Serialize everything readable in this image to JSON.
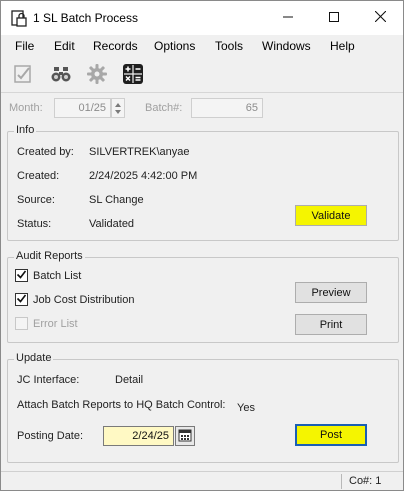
{
  "window": {
    "title": "1 SL Batch Process",
    "app_icon": "document-lock-icon",
    "controls": {
      "minimize": "minimize-icon",
      "maximize": "maximize-icon",
      "close": "close-icon"
    }
  },
  "menu": [
    "File",
    "Edit",
    "Records",
    "Options",
    "Tools",
    "Windows",
    "Help"
  ],
  "toolbar": [
    {
      "icon": "edit-check-icon",
      "enabled": false
    },
    {
      "icon": "binoculars-icon",
      "enabled": true
    },
    {
      "icon": "gear-icon",
      "enabled": false
    },
    {
      "icon": "calculator-icon",
      "enabled": true
    }
  ],
  "header": {
    "month_label": "Month:",
    "month_value": "01/25",
    "batch_label": "Batch#:",
    "batch_value": "65"
  },
  "info": {
    "title": "Info",
    "created_by_label": "Created by:",
    "created_by_value": "SILVERTREK\\anyae",
    "created_label": "Created:",
    "created_value": "2/24/2025 4:42:00 PM",
    "source_label": "Source:",
    "source_value": "SL Change",
    "status_label": "Status:",
    "status_value": "Validated",
    "validate_button": "Validate"
  },
  "audit": {
    "title": "Audit Reports",
    "batch_list_label": "Batch List",
    "batch_list_checked": true,
    "job_cost_label": "Job Cost Distribution",
    "job_cost_checked": true,
    "error_list_label": "Error List",
    "error_list_checked": false,
    "error_list_enabled": false,
    "preview_button": "Preview",
    "print_button": "Print"
  },
  "update": {
    "title": "Update",
    "jc_interface_label": "JC Interface:",
    "jc_interface_value": "Detail",
    "attach_label": "Attach Batch Reports to HQ Batch Control:",
    "attach_value": "Yes",
    "posting_date_label": "Posting Date:",
    "posting_date_value": "2/24/25",
    "calendar_icon": "calendar-icon",
    "post_button": "Post"
  },
  "status_bar": {
    "company": "Co#: 1"
  },
  "colors": {
    "highlight": "#f5f500",
    "date_field_bg": "#fff9c4",
    "focus_border": "#1a5fb4"
  }
}
